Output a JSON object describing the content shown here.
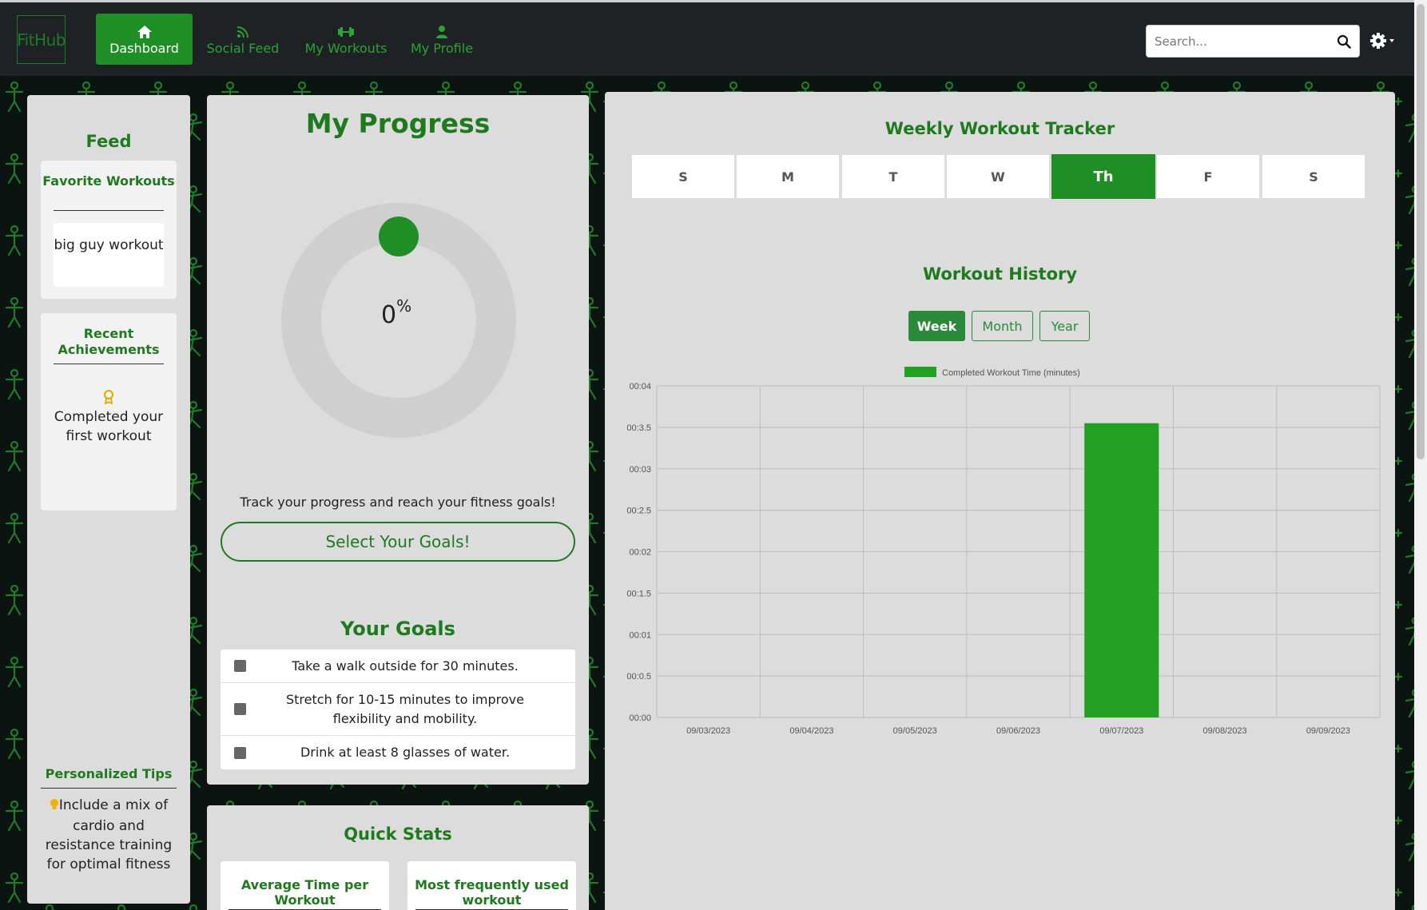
{
  "app": {
    "logo_text": "FitHub",
    "brand_color": "#1f8f25"
  },
  "nav": {
    "items": [
      {
        "label": "Dashboard",
        "icon": "home-icon",
        "active": true
      },
      {
        "label": "Social Feed",
        "icon": "rss-icon",
        "active": false
      },
      {
        "label": "My Workouts",
        "icon": "dumbbell-icon",
        "active": false
      },
      {
        "label": "My Profile",
        "icon": "user-icon",
        "active": false
      }
    ],
    "search_placeholder": "Search...",
    "settings_icon": "gear-icon"
  },
  "feed": {
    "title": "Feed",
    "favorite_title": "Favorite Workouts",
    "favorite_items": [
      "big guy workout"
    ],
    "achievements_title": "Recent Achievements",
    "achievement_icon": "award-icon",
    "achievements": [
      "Completed your first workout"
    ],
    "tips_title": "Personalized Tips",
    "tip_icon": "lightbulb-icon",
    "tip_text": "Include a mix of cardio and resistance training for optimal fitness"
  },
  "progress": {
    "title": "My Progress",
    "percent_value": "0",
    "percent_sign": "%",
    "track_text": "Track your progress and reach your fitness goals!",
    "select_goals_label": "Select Your Goals!",
    "goals_title": "Your Goals",
    "goals": [
      "Take a walk outside for 30 minutes.",
      "Stretch for 10-15 minutes to improve flexibility and mobility.",
      "Drink at least 8 glasses of water."
    ]
  },
  "quick_stats": {
    "title": "Quick Stats",
    "cards": [
      "Average Time per Workout",
      "Most frequently used workout"
    ]
  },
  "tracker": {
    "title": "Weekly Workout Tracker",
    "days": [
      "S",
      "M",
      "T",
      "W",
      "Th",
      "F",
      "S"
    ],
    "active_day_index": 4
  },
  "history": {
    "title": "Workout History",
    "ranges": [
      "Week",
      "Month",
      "Year"
    ],
    "active_range": "Week"
  },
  "chart_data": {
    "type": "bar",
    "categories": [
      "09/03/2023",
      "09/04/2023",
      "09/05/2023",
      "09/06/2023",
      "09/07/2023",
      "09/08/2023",
      "09/09/2023"
    ],
    "series": [
      {
        "name": "Completed Workout Time (minutes)",
        "values": [
          0,
          0,
          0,
          0,
          3.55,
          0,
          0
        ],
        "color": "#22a022"
      }
    ],
    "y_ticks": [
      "00:00",
      "00:0.5",
      "00:01",
      "00:1.5",
      "00:02",
      "00:2.5",
      "00:03",
      "00:3.5",
      "00:04"
    ],
    "ylim": [
      0,
      4
    ],
    "grid": true,
    "legend_position": "top"
  }
}
